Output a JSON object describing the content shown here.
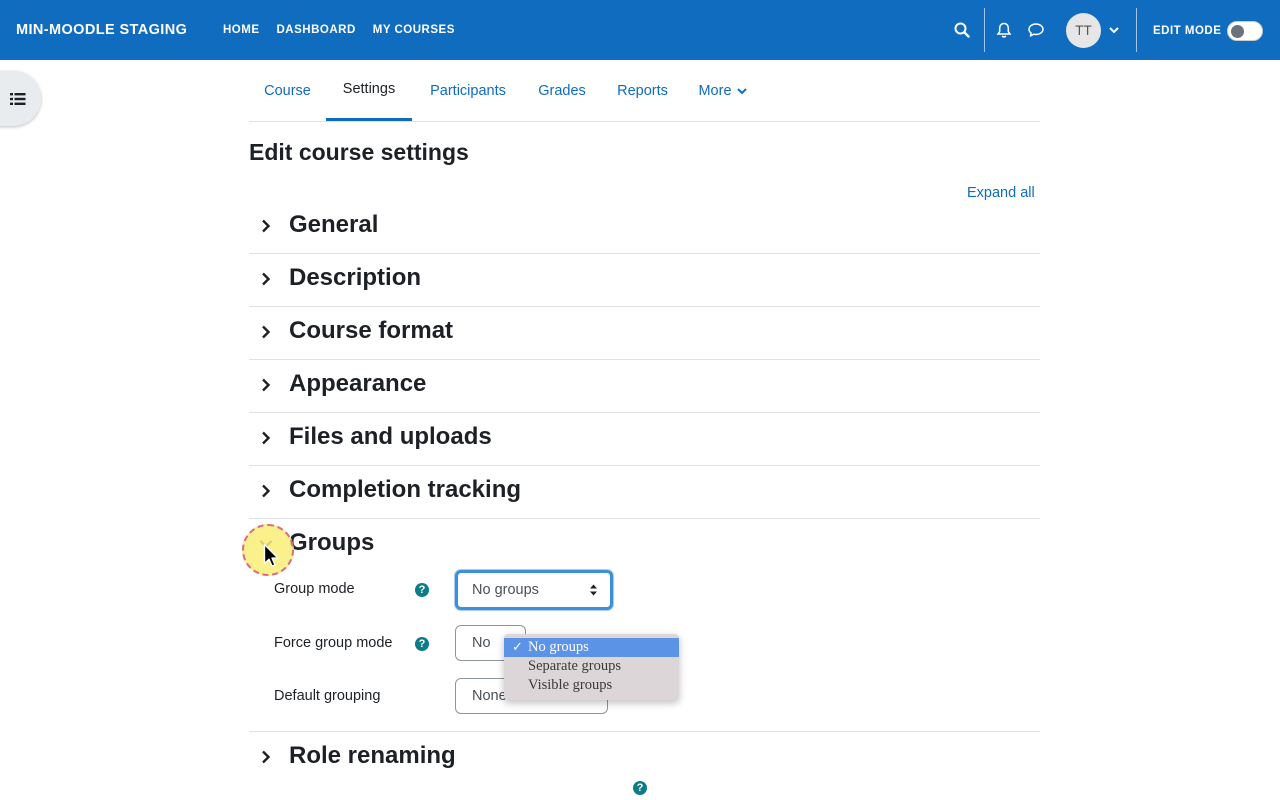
{
  "navbar": {
    "brand": "MIN-MOODLE STAGING",
    "links": [
      "HOME",
      "DASHBOARD",
      "MY COURSES"
    ],
    "icons": [
      "search-icon",
      "bell-icon",
      "chat-icon"
    ],
    "avatar_initials": "TT",
    "edit_mode_label": "EDIT MODE",
    "edit_mode_on": false
  },
  "secondary_nav": {
    "tabs": [
      "Course",
      "Settings",
      "Participants",
      "Grades",
      "Reports",
      "More"
    ],
    "active": "Settings"
  },
  "page": {
    "title": "Edit course settings",
    "expand_all": "Expand all"
  },
  "sections": [
    {
      "title": "General",
      "expanded": false
    },
    {
      "title": "Description",
      "expanded": false
    },
    {
      "title": "Course format",
      "expanded": false
    },
    {
      "title": "Appearance",
      "expanded": false
    },
    {
      "title": "Files and uploads",
      "expanded": false
    },
    {
      "title": "Completion tracking",
      "expanded": false
    },
    {
      "title": "Groups",
      "expanded": true
    },
    {
      "title": "Role renaming",
      "expanded": false
    }
  ],
  "groups_form": {
    "group_mode": {
      "label": "Group mode",
      "value": "No groups"
    },
    "force_group_mode": {
      "label": "Force group mode",
      "value": "No"
    },
    "default_grouping": {
      "label": "Default grouping",
      "value": "None"
    }
  },
  "dropdown": {
    "options": [
      "No groups",
      "Separate groups",
      "Visible groups"
    ],
    "selected": "No groups",
    "check": "✓"
  },
  "help_glyph": "?",
  "colors": {
    "brand": "#0f6cbf",
    "help": "#0e7c86",
    "focus": "#3d8fd9",
    "dropdown_selected": "#5b93e6"
  }
}
